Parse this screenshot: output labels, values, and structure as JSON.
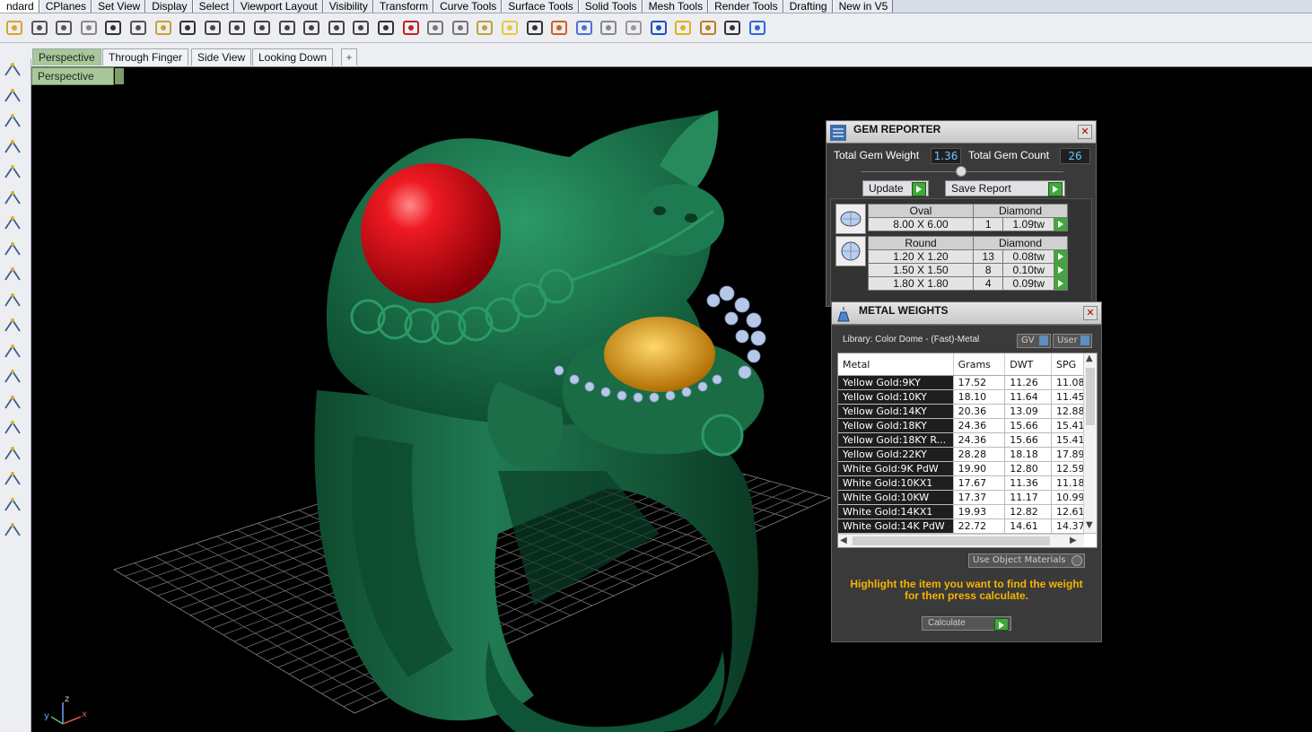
{
  "menu_tabs": [
    "ndard",
    "CPlanes",
    "Set View",
    "Display",
    "Select",
    "Viewport Layout",
    "Visibility",
    "Transform",
    "Curve Tools",
    "Surface Tools",
    "Solid Tools",
    "Mesh Tools",
    "Render Tools",
    "Drafting",
    "New in V5"
  ],
  "toolbar_icons": [
    "open-icon",
    "save-icon",
    "print-icon",
    "import-icon",
    "cut-icon",
    "copy-icon",
    "paste-icon",
    "undo-icon",
    "pan-icon",
    "move-view-icon",
    "zoom-icon",
    "zoom-window-icon",
    "zoom-extents-icon",
    "zoom-selected-icon",
    "rotate-view-icon",
    "four-viewports-icon",
    "car-icon",
    "camera-icon",
    "cplane-icon",
    "snap-icon",
    "light-icon",
    "lock-icon",
    "layer-icon",
    "color-wheel-icon",
    "shaded-sphere-icon",
    "render-sphere-icon",
    "globe-icon",
    "select-arrow-icon",
    "settings-icon",
    "grid-snap-icon",
    "help-icon"
  ],
  "viewport_tabs": {
    "perspective": "Perspective",
    "through_finger": "Through Finger",
    "side_view": "Side View",
    "looking_down": "Looking Down",
    "add": "+"
  },
  "viewport_label": "Perspective",
  "axis": {
    "x": "x",
    "y": "y",
    "z": "z"
  },
  "gem_reporter": {
    "title": "GEM REPORTER",
    "total_weight_label": "Total Gem Weight",
    "total_weight_value": "1.36",
    "total_count_label": "Total Gem Count",
    "total_count_value": "26",
    "update_label": "Update",
    "save_report_label": "Save Report",
    "groups": [
      {
        "shape": "Oval",
        "type": "Diamond",
        "rows": [
          {
            "size": "8.00 X 6.00",
            "count": "1",
            "weight": "1.09tw"
          }
        ]
      },
      {
        "shape": "Round",
        "type": "Diamond",
        "rows": [
          {
            "size": "1.20 X 1.20",
            "count": "13",
            "weight": "0.08tw"
          },
          {
            "size": "1.50 X 1.50",
            "count": "8",
            "weight": "0.10tw"
          },
          {
            "size": "1.80 X 1.80",
            "count": "4",
            "weight": "0.09tw"
          }
        ]
      }
    ]
  },
  "metal_weights": {
    "title": "METAL WEIGHTS",
    "library": "Library: Color Dome - (Fast)-Metal",
    "gv_label": "GV",
    "user_label": "User",
    "columns": [
      "Metal",
      "Grams",
      "DWT",
      "SPG"
    ],
    "rows": [
      [
        "Yellow Gold:9KY",
        "17.52",
        "11.26",
        "11.08"
      ],
      [
        "Yellow Gold:10KY",
        "18.10",
        "11.64",
        "11.45"
      ],
      [
        "Yellow Gold:14KY",
        "20.36",
        "13.09",
        "12.88"
      ],
      [
        "Yellow Gold:18KY",
        "24.36",
        "15.66",
        "15.41"
      ],
      [
        "Yellow Gold:18KY R...",
        "24.36",
        "15.66",
        "15.41"
      ],
      [
        "Yellow Gold:22KY",
        "28.28",
        "18.18",
        "17.89"
      ],
      [
        "White Gold:9K PdW",
        "19.90",
        "12.80",
        "12.59"
      ],
      [
        "White Gold:10KX1",
        "17.67",
        "11.36",
        "11.18"
      ],
      [
        "White Gold:10KW",
        "17.37",
        "11.17",
        "10.99"
      ],
      [
        "White Gold:14KX1",
        "19.93",
        "12.82",
        "12.61"
      ],
      [
        "White Gold:14K PdW",
        "22.72",
        "14.61",
        "14.37"
      ]
    ],
    "use_object_materials": "Use Object Materials",
    "hint": "Highlight the item you want to find the weight for then press calculate.",
    "calculate_label": "Calculate"
  },
  "colors": {
    "ring": "#1d6a48",
    "gem_red": "#e0101a",
    "gem_yellow": "#e8a010",
    "hint": "#f6b300",
    "viewport_tab": "#a9c79a"
  }
}
